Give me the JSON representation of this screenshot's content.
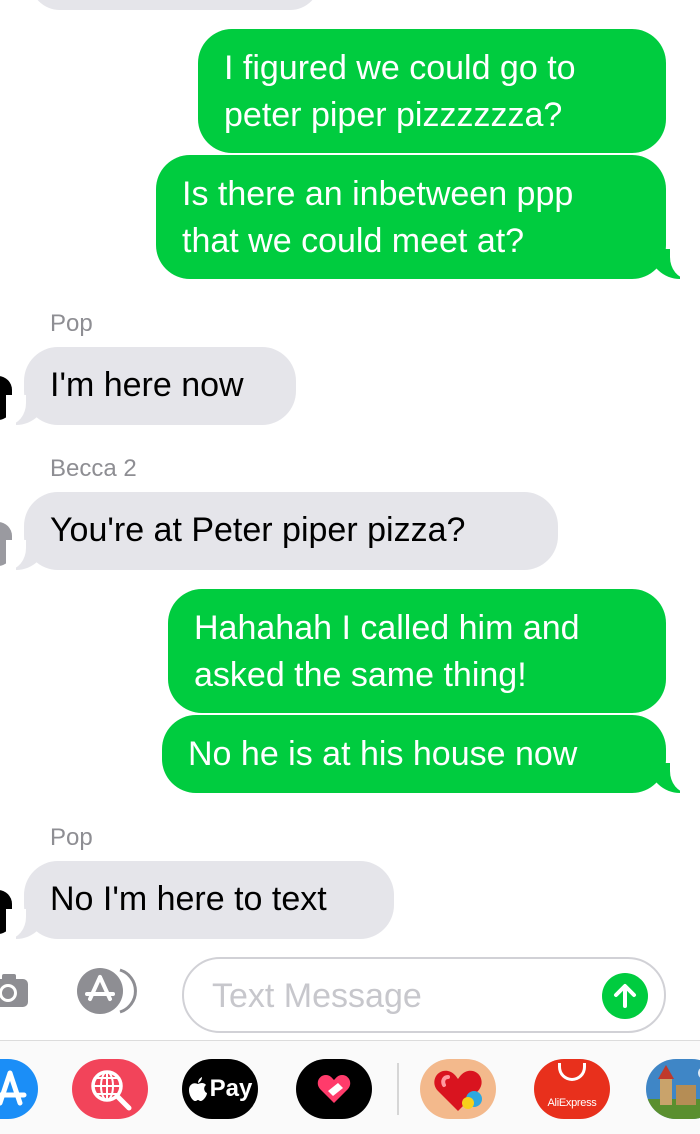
{
  "messages": [
    {
      "from": "me",
      "lines": [
        "I figured we could go to",
        "peter piper pizzzzzza?"
      ]
    },
    {
      "from": "me",
      "lines": [
        "Is there an inbetween ppp",
        "that we could meet at?"
      ]
    },
    {
      "from": "them",
      "sender": "Pop",
      "lines": [
        "I'm here now"
      ]
    },
    {
      "from": "them",
      "sender": "Becca 2",
      "lines": [
        "You're at Peter piper pizza?"
      ]
    },
    {
      "from": "me",
      "lines": [
        "Hahahah I called him and",
        "asked the same thing!"
      ]
    },
    {
      "from": "me",
      "lines": [
        "No he is at his house now"
      ]
    },
    {
      "from": "them",
      "sender": "Pop",
      "lines": [
        "No I'm here to text"
      ]
    }
  ],
  "composer": {
    "placeholder": "Text Message",
    "value": ""
  },
  "app_drawer": {
    "apps": [
      {
        "name": "App Store",
        "icon": "appstore-icon"
      },
      {
        "name": "Search Images",
        "icon": "globe-search-icon"
      },
      {
        "name": "Apple Pay",
        "label": "Pay",
        "icon": "apple-pay-icon"
      },
      {
        "name": "Digital Touch",
        "icon": "heart-icon"
      },
      {
        "name": "Game",
        "icon": "game-icon"
      },
      {
        "name": "AliExpress",
        "label": "AliExpress",
        "icon": "aliexpress-icon"
      },
      {
        "name": "Castle Game",
        "icon": "castle-icon"
      }
    ]
  },
  "colors": {
    "sent_bubble": "#00cc3f",
    "received_bubble": "#e5e5ea",
    "sender_label": "#8e8e93"
  }
}
